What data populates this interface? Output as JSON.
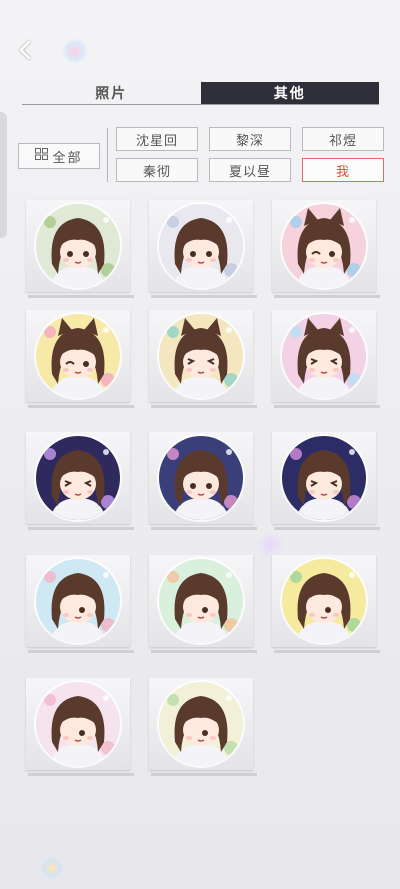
{
  "tabs": [
    {
      "label": "照片",
      "active": false
    },
    {
      "label": "其他",
      "active": true
    }
  ],
  "filter_all": "全部",
  "characters": [
    {
      "label": "沈星回",
      "selected": false
    },
    {
      "label": "黎深",
      "selected": false
    },
    {
      "label": "祁煜",
      "selected": false
    },
    {
      "label": "秦彻",
      "selected": false
    },
    {
      "label": "夏以昼",
      "selected": false
    },
    {
      "label": "我",
      "selected": true
    }
  ],
  "badges": [
    {
      "bg": "#dfe9d6",
      "accent": "#a7c98a",
      "ears": false,
      "face": "smile"
    },
    {
      "bg": "#e8e8ee",
      "accent": "#bfc8e2",
      "ears": false,
      "face": "smile"
    },
    {
      "bg": "#f6d2dc",
      "accent": "#9ed0e8",
      "ears": true,
      "face": "wink"
    },
    {
      "bg": "#f7e9a8",
      "accent": "#f3a8c0",
      "ears": true,
      "face": "wink"
    },
    {
      "bg": "#f4e7bf",
      "accent": "#8ed2c8",
      "ears": true,
      "face": "closed"
    },
    {
      "bg": "#f3d2e6",
      "accent": "#b8e0f2",
      "ears": true,
      "face": "closed"
    },
    {
      "bg": "#2f2a5e",
      "accent": "#c79af0",
      "ears": false,
      "face": "closed"
    },
    {
      "bg": "#3a3f7a",
      "accent": "#e69ad6",
      "ears": false,
      "face": "smile"
    },
    {
      "bg": "#2c2d66",
      "accent": "#d58fe0",
      "ears": false,
      "face": "closed"
    },
    {
      "bg": "#cfe9f4",
      "accent": "#f2b3c3",
      "ears": false,
      "face": "side"
    },
    {
      "bg": "#d9f0dc",
      "accent": "#f2c09a",
      "ears": false,
      "face": "side"
    },
    {
      "bg": "#f6ea9e",
      "accent": "#9ed49a",
      "ears": false,
      "face": "side"
    },
    {
      "bg": "#f5e4ee",
      "accent": "#f0b8cc",
      "ears": false,
      "face": "side"
    },
    {
      "bg": "#f3f0d8",
      "accent": "#b6dca8",
      "ears": false,
      "face": "side"
    }
  ]
}
